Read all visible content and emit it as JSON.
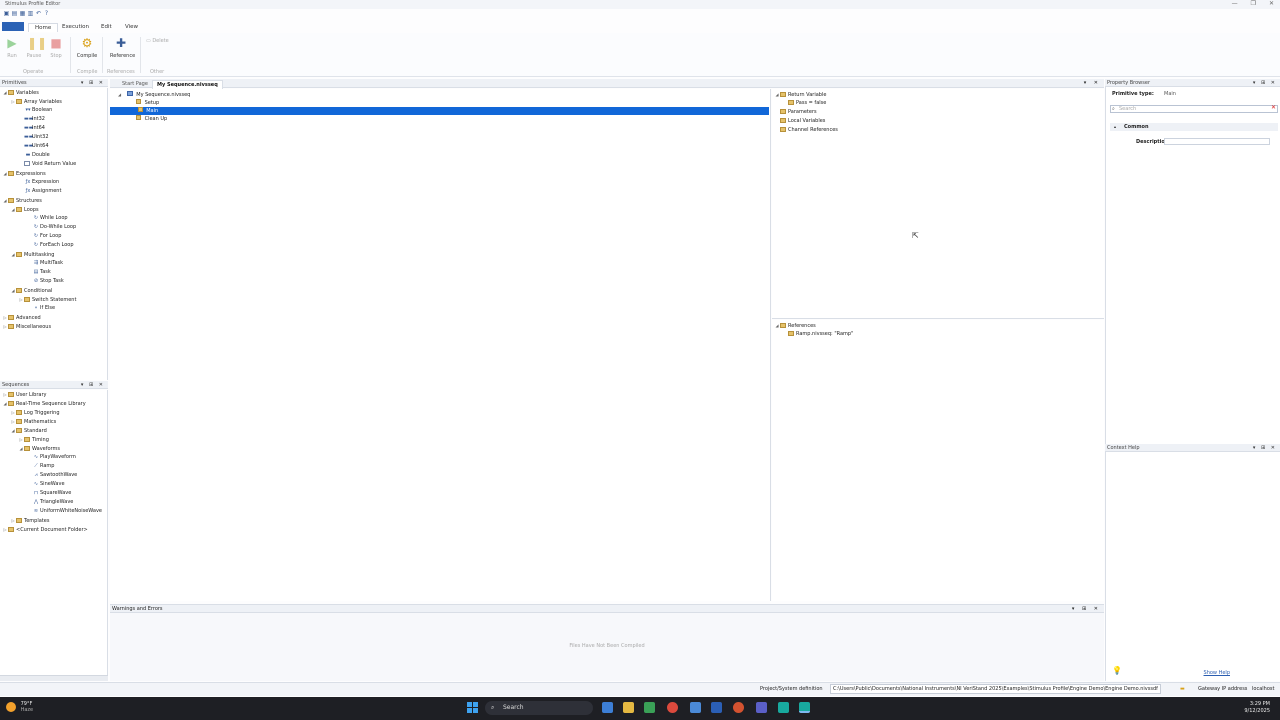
{
  "window": {
    "title": "Stimulus Profile Editor",
    "controls": [
      "—",
      "❐",
      "✕"
    ]
  },
  "menu": {
    "file_label": "",
    "tabs": [
      "Home",
      "Execution",
      "Edit",
      "View"
    ]
  },
  "ribbon": {
    "run": "Run",
    "pause": "Pause",
    "stop": "Stop",
    "compile": "Compile",
    "reference": "Reference",
    "delete": "Delete",
    "groups": [
      "Operate",
      "Compile",
      "References",
      "Other"
    ]
  },
  "primitives": {
    "title": "Primitives",
    "items": [
      {
        "label": "Variables",
        "level": 0,
        "kind": "folder",
        "toggle": "◢"
      },
      {
        "label": "Array Variables",
        "level": 1,
        "kind": "folder",
        "toggle": "▷"
      },
      {
        "label": "Boolean",
        "level": 2,
        "kind": "glyph",
        "glyph": "▾▾"
      },
      {
        "label": "Int32",
        "level": 2,
        "kind": "glyph",
        "glyph": "▬▬"
      },
      {
        "label": "Int64",
        "level": 2,
        "kind": "glyph",
        "glyph": "▬▬"
      },
      {
        "label": "Uint32",
        "level": 2,
        "kind": "glyph",
        "glyph": "▬▬"
      },
      {
        "label": "Uint64",
        "level": 2,
        "kind": "glyph",
        "glyph": "▬▬"
      },
      {
        "label": "Double",
        "level": 2,
        "kind": "glyph",
        "glyph": "▬"
      },
      {
        "label": "Void Return Value",
        "level": 2,
        "kind": "doc"
      },
      {
        "label": "Expressions",
        "level": 0,
        "kind": "folder",
        "toggle": "◢"
      },
      {
        "label": "Expression",
        "level": 2,
        "kind": "glyph",
        "glyph": "ƒx"
      },
      {
        "label": "Assignment",
        "level": 2,
        "kind": "glyph",
        "glyph": "ƒx"
      },
      {
        "label": "Structures",
        "level": 0,
        "kind": "folder",
        "toggle": "◢"
      },
      {
        "label": "Loops",
        "level": 1,
        "kind": "folder",
        "toggle": "◢"
      },
      {
        "label": "While Loop",
        "level": 3,
        "kind": "glyph",
        "glyph": "↻"
      },
      {
        "label": "Do-While Loop",
        "level": 3,
        "kind": "glyph",
        "glyph": "↻"
      },
      {
        "label": "For Loop",
        "level": 3,
        "kind": "glyph",
        "glyph": "↻"
      },
      {
        "label": "ForEach Loop",
        "level": 3,
        "kind": "glyph",
        "glyph": "↻"
      },
      {
        "label": "Multitasking",
        "level": 1,
        "kind": "folder",
        "toggle": "◢"
      },
      {
        "label": "MultiTask",
        "level": 3,
        "kind": "glyph",
        "glyph": "⇶"
      },
      {
        "label": "Task",
        "level": 3,
        "kind": "glyph",
        "glyph": "▤"
      },
      {
        "label": "Stop Task",
        "level": 3,
        "kind": "glyph",
        "glyph": "⊘"
      },
      {
        "label": "Conditional",
        "level": 1,
        "kind": "folder",
        "toggle": "◢"
      },
      {
        "label": "Switch Statement",
        "level": 2,
        "kind": "folder",
        "toggle": "▷"
      },
      {
        "label": "If Else",
        "level": 3,
        "kind": "glyph",
        "glyph": "⑂"
      },
      {
        "label": "Advanced",
        "level": 0,
        "kind": "folder",
        "toggle": "▷"
      },
      {
        "label": "Miscellaneous",
        "level": 0,
        "kind": "folder",
        "toggle": "▷"
      }
    ]
  },
  "sequences": {
    "title": "Sequences",
    "items": [
      {
        "label": "User Library",
        "level": 0,
        "kind": "folder",
        "toggle": "▷"
      },
      {
        "label": "Real-Time Sequence Library",
        "level": 0,
        "kind": "folder",
        "toggle": "◢"
      },
      {
        "label": "Log Triggering",
        "level": 1,
        "kind": "folder",
        "toggle": "▷"
      },
      {
        "label": "Mathematics",
        "level": 1,
        "kind": "folder",
        "toggle": "▷"
      },
      {
        "label": "Standard",
        "level": 1,
        "kind": "folder",
        "toggle": "◢"
      },
      {
        "label": "Timing",
        "level": 2,
        "kind": "folder",
        "toggle": "▷"
      },
      {
        "label": "Waveforms",
        "level": 2,
        "kind": "folder",
        "toggle": "◢"
      },
      {
        "label": "PlayWaveform",
        "level": 3,
        "kind": "glyph",
        "glyph": "∿"
      },
      {
        "label": "Ramp",
        "level": 3,
        "kind": "glyph",
        "glyph": "⟋"
      },
      {
        "label": "SawtoothWave",
        "level": 3,
        "kind": "glyph",
        "glyph": "⩘"
      },
      {
        "label": "SineWave",
        "level": 3,
        "kind": "glyph",
        "glyph": "∿"
      },
      {
        "label": "SquareWave",
        "level": 3,
        "kind": "glyph",
        "glyph": "⊓"
      },
      {
        "label": "TriangleWave",
        "level": 3,
        "kind": "glyph",
        "glyph": "⋀"
      },
      {
        "label": "UniformWhiteNoiseWave",
        "level": 3,
        "kind": "glyph",
        "glyph": "≋"
      },
      {
        "label": "Templates",
        "level": 1,
        "kind": "folder",
        "toggle": "▷"
      },
      {
        "label": "<Current Document Folder>",
        "level": 0,
        "kind": "folder",
        "toggle": "▷"
      }
    ]
  },
  "document": {
    "tabs": [
      "Start Page",
      "My Sequence.nivsseq"
    ],
    "tree": [
      {
        "label": "My Sequence.nivsseq",
        "level": 0,
        "toggle": "◢"
      },
      {
        "label": "Setup",
        "level": 2
      },
      {
        "label": "Main",
        "level": 2,
        "selected": true
      },
      {
        "label": "Clean Up",
        "level": 2
      }
    ]
  },
  "variables": {
    "items": [
      {
        "label": "Return Variable",
        "level": 0,
        "toggle": "◢"
      },
      {
        "label": "Pass = false",
        "level": 1
      },
      {
        "label": "Parameters",
        "level": 0
      },
      {
        "label": "Local Variables",
        "level": 0
      },
      {
        "label": "Channel References",
        "level": 0
      }
    ]
  },
  "references": {
    "items": [
      {
        "label": "References",
        "level": 0,
        "toggle": "◢"
      },
      {
        "label": "Ramp.nivsseq: \"Ramp\"",
        "level": 1
      }
    ]
  },
  "warnings": {
    "title": "Warnings and Errors",
    "message": "Files Have Not Been Compiled"
  },
  "property_browser": {
    "title": "Property Browser",
    "primitive_type_label": "Primitive type:",
    "primitive_type_value": "Main",
    "search_placeholder": "Search",
    "category": "Common",
    "description_label": "Description"
  },
  "context_help": {
    "title": "Context Help",
    "show_help": "Show Help"
  },
  "status": {
    "project_label": "Project/System definition",
    "project_path": "C:\\Users\\Public\\Documents\\National Instruments\\NI VeriStand 2025\\Examples\\Stimulus Profile\\Engine Demo\\Engine Demo.nivssdf",
    "gateway_label": "Gateway IP address",
    "gateway_value": "localhost"
  },
  "taskbar": {
    "temp": "79°F",
    "weather": "Haze",
    "search": "Search",
    "time": "3:29 PM",
    "date": "9/12/2025"
  },
  "colors": {
    "selection": "#1167d8",
    "accent": "#2b62b5",
    "folder": "#e5c26a"
  }
}
